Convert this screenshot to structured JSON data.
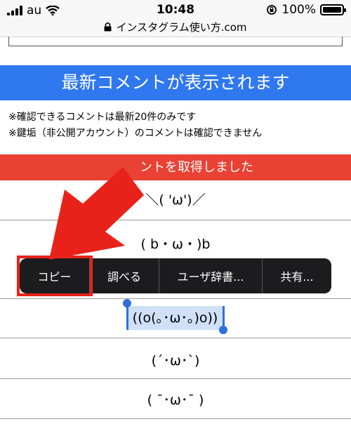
{
  "status_bar": {
    "carrier": "au",
    "time": "10:48",
    "battery": "100%",
    "battery_level": 100,
    "url": "インスタグラム使い方.com"
  },
  "banner": {
    "title": "最新コメントが表示されます"
  },
  "notes": [
    "※確認できるコメントは最新20件のみです",
    "※鍵垢（非公開アカウント）のコメントは確認できません"
  ],
  "result_bar": {
    "text": "ントを取得しました"
  },
  "comments": [
    "＼( 'ω')／",
    "( b・ω・)b",
    "((o(｡･ω･｡)o))",
    "(´･ω･`)",
    "( ¯･ω･¯ )"
  ],
  "context_menu": {
    "items": [
      "コピー",
      "調べる",
      "ユーザ辞書...",
      "共有..."
    ]
  },
  "colors": {
    "banner": "#2f78ef",
    "result_bar": "#e94133",
    "arrow": "#e8221b",
    "selection": "#cfe0f7"
  }
}
